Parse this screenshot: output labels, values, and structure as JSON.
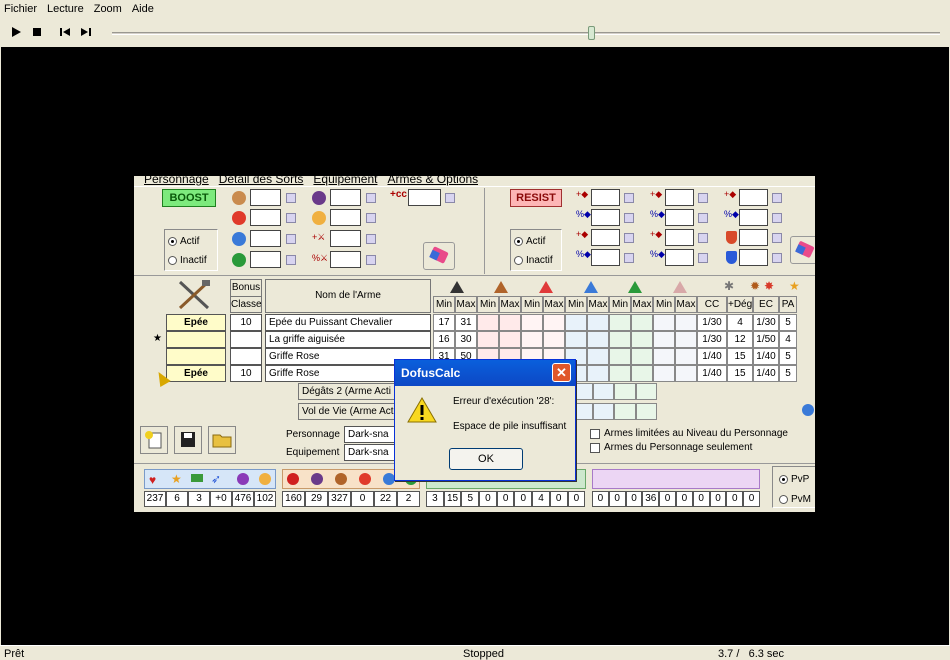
{
  "menu": {
    "items": [
      "Fichier",
      "Lecture",
      "Zoom",
      "Aide"
    ]
  },
  "status": {
    "left": "Prêt",
    "center": "Stopped",
    "right": "3.7 /   6.3 sec"
  },
  "app": {
    "tabs": [
      "Personnage",
      "Détail des Sorts",
      "Équipement",
      "Armes & Options"
    ],
    "boost_label": "BOOST",
    "resist_label": "RESIST",
    "radio_actif": "Actif",
    "radio_inactif": "Inactif",
    "headers": {
      "bonus": "Bonus",
      "classe": "Classe",
      "nom": "Nom de l'Arme",
      "min": "Min",
      "max": "Max",
      "cc": "CC",
      "deg": "+Dég.",
      "ec": "EC",
      "pa": "PA"
    },
    "weapons": [
      {
        "type": "Epée",
        "bonus": "10",
        "name": "Epée du Puissant Chevalier",
        "min": "17",
        "max": "31",
        "cc": "1/30",
        "deg": "4",
        "ec": "1/30",
        "pa": "5"
      },
      {
        "type": "",
        "bonus": "",
        "name": "La griffe aiguisée",
        "min": "16",
        "max": "30",
        "cc": "1/30",
        "deg": "12",
        "ec": "1/50",
        "pa": "4"
      },
      {
        "type": "",
        "bonus": "",
        "name": "Griffe Rose",
        "min": "31",
        "max": "50",
        "cc": "1/40",
        "deg": "15",
        "ec": "1/40",
        "pa": "5"
      },
      {
        "type": "Epée",
        "bonus": "10",
        "name": "Griffe Rose",
        "min": "",
        "max": "",
        "cc": "1/40",
        "deg": "15",
        "ec": "1/40",
        "pa": "5"
      }
    ],
    "degats_label": "Dégâts 2   (Arme Acti",
    "vol_label": "Vol de Vie  (Arme Acti",
    "personnage_label": "Personnage",
    "personnage_value": "Dark-sna",
    "equipement_label": "Equipement",
    "equipement_value": "Dark-sna",
    "check1": "Armes limitées au Niveau du Personnage",
    "check2": "Armes du Personnage seulement",
    "pvp": "PvP",
    "pvm": "PvM",
    "stats1": [
      "237",
      "6",
      "3",
      "+0",
      "476",
      "102"
    ],
    "stats2": [
      "160",
      "29",
      "327",
      "0",
      "22",
      "2"
    ],
    "stats3": [
      "3",
      "15",
      "5",
      "0",
      "0",
      "0",
      "4",
      "0",
      "0"
    ],
    "stats4": [
      "0",
      "0",
      "0",
      "36",
      "0",
      "0",
      "0",
      "0",
      "0",
      "0"
    ]
  },
  "dialog": {
    "title": "DofusCalc",
    "line1": "Erreur d'exécution '28':",
    "line2": "Espace de pile insuffisant",
    "ok": "OK"
  }
}
